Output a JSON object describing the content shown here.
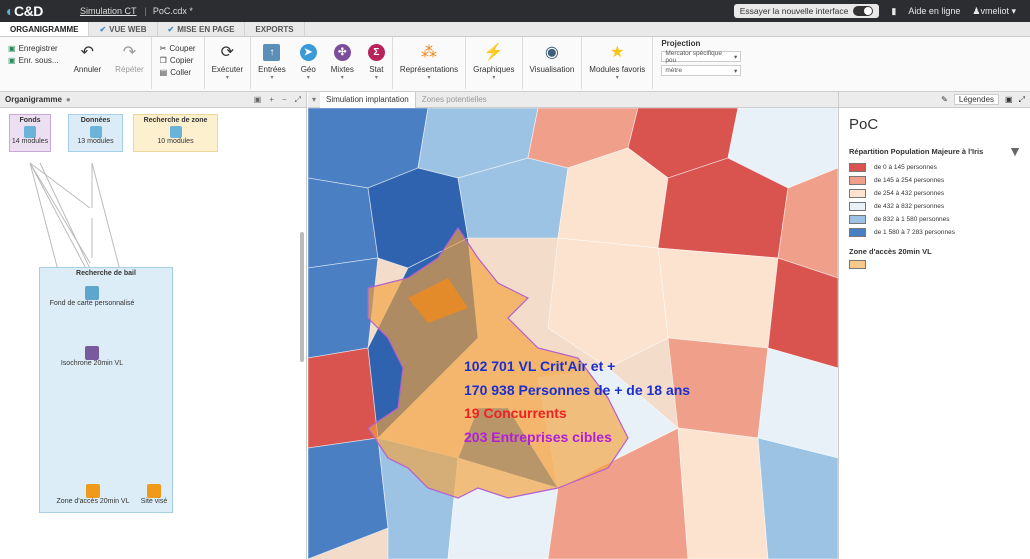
{
  "topbar": {
    "logo_text": "C&D",
    "breadcrumb_project": "Simulation CT",
    "breadcrumb_file": "PoC.cdx *",
    "try_interface": "Essayer la nouvelle interface",
    "help": "Aide en ligne",
    "user": "vmeliot"
  },
  "tabs": [
    {
      "label": "ORGANIGRAMME"
    },
    {
      "label": "VUE WEB"
    },
    {
      "label": "MISE EN PAGE"
    },
    {
      "label": "EXPORTS"
    }
  ],
  "ribbon": {
    "save": "Enregistrer",
    "save_as": "Enr. sous...",
    "undo": "Annuler",
    "redo": "Répéter",
    "cut": "Couper",
    "copy": "Copier",
    "paste": "Coller",
    "execute": "Exécuter",
    "inputs": "Entrées",
    "geo": "Géo",
    "mixed": "Mixtes",
    "stat": "Stat",
    "representations": "Représentations",
    "charts": "Graphiques",
    "visualisation": "Visualisation",
    "favorites": "Modules favoris",
    "projection_title": "Projection",
    "projection_value": "Mercator spécifique pou",
    "unit_value": "mètre"
  },
  "left_panel": {
    "title": "Organigramme",
    "nodes": {
      "fonds_title": "Fonds",
      "fonds_count": "14 modules",
      "donnees_title": "Données",
      "donnees_count": "13 modules",
      "zone_title": "Recherche de zone",
      "zone_count": "10 modules",
      "bail_title": "Recherche de bail",
      "fond_carte": "Fond de carte personnalisé",
      "isochrone": "Isochrone 20min VL",
      "zone_acces": "Zone d'accès 20min VL",
      "site_vise": "Site visé"
    }
  },
  "map_panel": {
    "tab_active": "Simulation implantation",
    "tab_other": "Zones potentielles",
    "stats": [
      {
        "text": "102 701  VL Crit'Air et +",
        "color": "#1a2fd0"
      },
      {
        "text": "170 938 Personnes de + de 18 ans",
        "color": "#1a2fd0"
      },
      {
        "text": "19  Concurrents",
        "color": "#ee2222"
      },
      {
        "text": "203  Entreprises cibles",
        "color": "#b020d8"
      }
    ]
  },
  "legend_panel": {
    "tab": "Légendes",
    "title": "PoC",
    "layer1_title": "Répartition Population Majeure à l'Iris",
    "classes": [
      {
        "label": "de 0 à 145 personnes",
        "color": "#d9534f"
      },
      {
        "label": "de 145 à 254 personnes",
        "color": "#f0a08a"
      },
      {
        "label": "de 254 à 432 personnes",
        "color": "#fbe3cf"
      },
      {
        "label": "de 432 à 832 personnes",
        "color": "#e8f1f8"
      },
      {
        "label": "de 832 à 1 580 personnes",
        "color": "#9cc3e4"
      },
      {
        "label": "de 1 580 à 7 283 personnes",
        "color": "#4a7fc4"
      }
    ],
    "layer2_title": "Zone d'accès 20min VL",
    "layer2_color": "#f5c98a"
  }
}
